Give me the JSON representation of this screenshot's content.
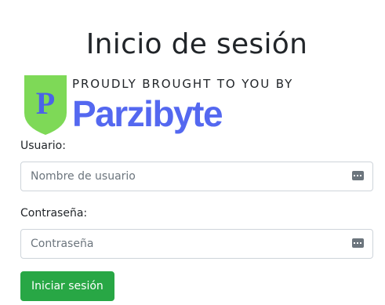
{
  "page": {
    "title": "Inicio de sesión"
  },
  "brand": {
    "tagline": "PROUDLY BROUGHT TO YOU BY",
    "name": "Parzibyte",
    "logo_letter": "P",
    "colors": {
      "shield": "#7ed957",
      "letter": "#4a63e8",
      "name": "#5468f0"
    }
  },
  "form": {
    "username": {
      "label": "Usuario:",
      "placeholder": "Nombre de usuario",
      "value": "",
      "icon": "password-manager-icon"
    },
    "password": {
      "label": "Contraseña:",
      "placeholder": "Contraseña",
      "value": "",
      "icon": "password-manager-icon"
    },
    "submit_label": "Iniciar sesión",
    "submit_color": "#28a745"
  }
}
